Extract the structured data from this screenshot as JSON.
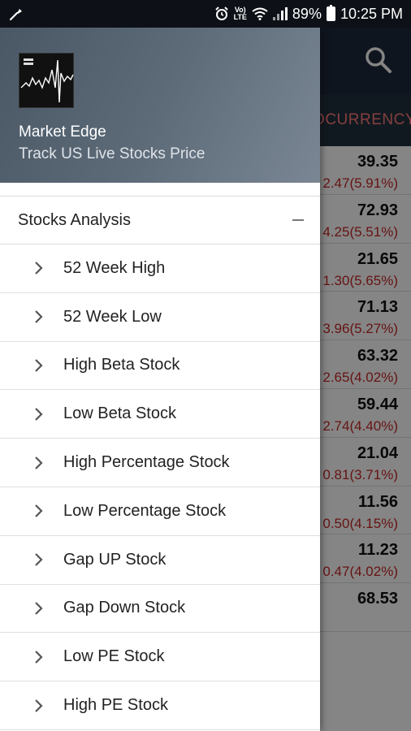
{
  "status_bar": {
    "battery": "89%",
    "time": "10:25 PM",
    "volte_top": "Vo)",
    "volte_bottom": "LTE"
  },
  "background_app": {
    "tab_label": "TOCURRENCY",
    "rows": [
      {
        "price": "39.35",
        "change": "2.47(5.91%)"
      },
      {
        "price": "72.93",
        "change": "4.25(5.51%)"
      },
      {
        "price": "21.65",
        "change": "1.30(5.65%)"
      },
      {
        "price": "71.13",
        "change": "3.96(5.27%)"
      },
      {
        "price": "63.32",
        "change": "2.65(4.02%)"
      },
      {
        "price": "59.44",
        "change": "2.74(4.40%)"
      },
      {
        "price": "21.04",
        "change": "0.81(3.71%)"
      },
      {
        "price": "11.56",
        "change": "0.50(4.15%)"
      },
      {
        "price": "11.23",
        "change": "0.47(4.02%)"
      },
      {
        "price": "68.53",
        "change": ""
      }
    ]
  },
  "drawer": {
    "app_name": "Market Edge",
    "tagline": "Track US Live Stocks Price",
    "section_title": "Stocks Analysis",
    "items": [
      {
        "label": "52 Week High"
      },
      {
        "label": "52 Week Low"
      },
      {
        "label": "High Beta Stock"
      },
      {
        "label": "Low Beta Stock"
      },
      {
        "label": "High Percentage Stock"
      },
      {
        "label": "Low Percentage Stock"
      },
      {
        "label": "Gap UP Stock"
      },
      {
        "label": "Gap Down Stock"
      },
      {
        "label": "Low PE Stock"
      },
      {
        "label": "High PE Stock"
      }
    ]
  },
  "colors": {
    "toolbar": "#1e2a3a",
    "negative": "#c62828",
    "tab_accent": "#ff7a7a"
  }
}
